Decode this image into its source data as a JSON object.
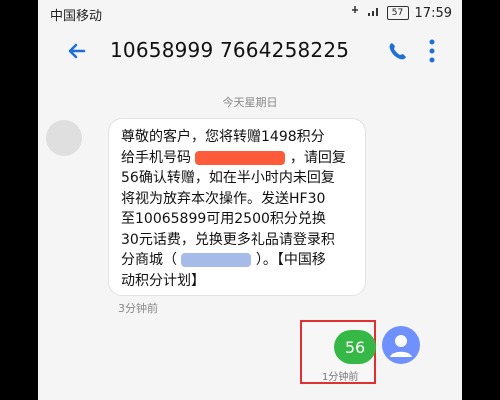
{
  "statusbar": {
    "carrier": "中国移动",
    "battery": "57",
    "time": "17:59"
  },
  "header": {
    "title": "10658999 7664258225",
    "back_icon": "back-arrow-icon",
    "call_icon": "phone-icon",
    "menu_icon": "more-vert-icon"
  },
  "conversation": {
    "date_separator": "今天星期日",
    "incoming": {
      "lines": [
        "尊敬的客户，您将转赠1498积分",
        "给手机号码",
        "，请回复",
        "56确认转赠，如在半小时内未回复",
        "将视为放弃本次操作。发送HF30",
        "至10065899可用2500积分兑换",
        "30元话费，兑换更多礼品请登录积",
        "分商城（",
        "）。【中国移",
        "动积分计划】"
      ],
      "time": "3分钟前"
    },
    "outgoing": {
      "text": "56",
      "time": "1分钟前"
    }
  },
  "colors": {
    "background": "#f5f5f5",
    "incoming_bubble": "#ffffff",
    "outgoing_bubble": "#36b846",
    "highlight_box": "#e03030",
    "icon_blue": "#1f6fd6",
    "outgoing_avatar": "#6f90ff"
  }
}
